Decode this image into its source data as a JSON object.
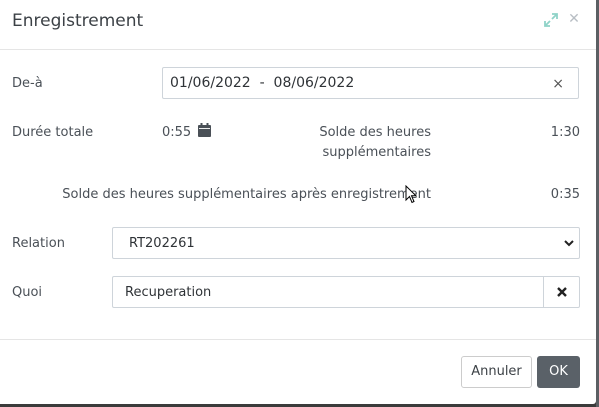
{
  "dialog": {
    "title": "Enregistrement"
  },
  "date_range": {
    "label": "De-à",
    "value": "01/06/2022  -  08/06/2022",
    "clear_icon": "×"
  },
  "summary": {
    "total_duration_label": "Durée totale",
    "total_duration_value": "0:55",
    "overtime_balance_label_line1": "Solde des heures",
    "overtime_balance_label_line2": "supplémentaires",
    "overtime_balance_value": "1:30",
    "overtime_after_label": "Solde des heures supplémentaires après enregistrement",
    "overtime_after_value": "0:35"
  },
  "relation": {
    "label": "Relation",
    "selected": "RT202261"
  },
  "quoi": {
    "label": "Quoi",
    "value": "Recuperation"
  },
  "buttons": {
    "cancel": "Annuler",
    "ok": "OK"
  },
  "icons": {
    "expand": "expand-icon",
    "close": "close-icon",
    "calendar": "calendar-icon",
    "chevron": "chevron-down-icon",
    "clear": "clear-icon"
  },
  "colors": {
    "primary_button": "#5a6168",
    "text": "#4a5057",
    "expand_icon": "#8fd3c8"
  }
}
